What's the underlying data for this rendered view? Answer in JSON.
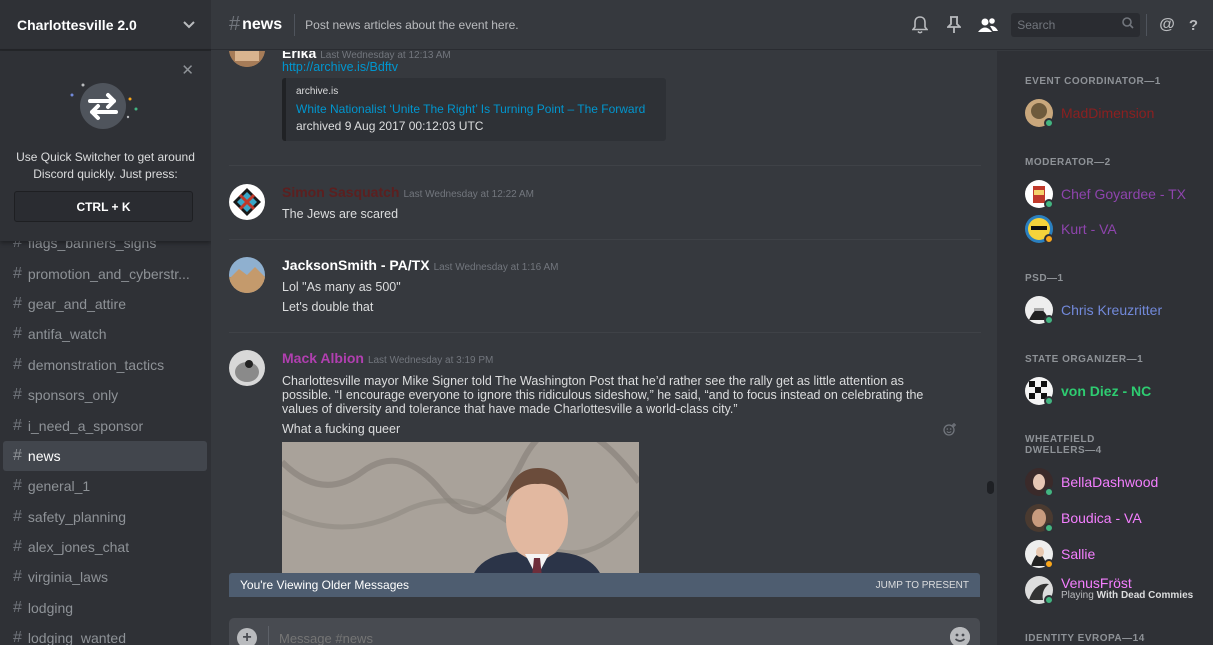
{
  "guild": {
    "name": "Charlottesville 2.0"
  },
  "quick_switcher": {
    "text": "Use Quick Switcher to get around Discord quickly. Just press:",
    "shortcut": "CTRL + K"
  },
  "channels": [
    {
      "name": "flags_banners_signs",
      "active": false
    },
    {
      "name": "promotion_and_cyberstr...",
      "active": false
    },
    {
      "name": "gear_and_attire",
      "active": false
    },
    {
      "name": "antifa_watch",
      "active": false
    },
    {
      "name": "demonstration_tactics",
      "active": false
    },
    {
      "name": "sponsors_only",
      "active": false
    },
    {
      "name": "i_need_a_sponsor",
      "active": false
    },
    {
      "name": "news",
      "active": true
    },
    {
      "name": "general_1",
      "active": false
    },
    {
      "name": "safety_planning",
      "active": false
    },
    {
      "name": "alex_jones_chat",
      "active": false
    },
    {
      "name": "virginia_laws",
      "active": false
    },
    {
      "name": "lodging",
      "active": false
    },
    {
      "name": "lodging_wanted",
      "active": false
    }
  ],
  "header": {
    "hash": "#",
    "channel": "news",
    "topic": "Post news articles about the event here.",
    "search_placeholder": "Search",
    "at": "@",
    "help": "?"
  },
  "messages": [
    {
      "author": "Erika",
      "color": "#ffffff",
      "timestamp": "Last Wednesday at 12:13 AM",
      "lines": [
        "http://archive.is/Bdftv"
      ],
      "embed": {
        "provider": "archive.is",
        "title": "White Nationalist ‘Unite The Right’ Is Turning Point – The Forward",
        "description": "archived 9 Aug 2017 00:12:03 UTC"
      }
    },
    {
      "author": "Simon Sasquatch",
      "color": "#5c1f1f",
      "timestamp": "Last Wednesday at 12:22 AM",
      "lines": [
        "The Jews are scared"
      ]
    },
    {
      "author": "JacksonSmith - PA/TX",
      "color": "#ffffff",
      "timestamp": "Last Wednesday at 1:16 AM",
      "lines": [
        "Lol \"As many as 500\"",
        "Let's double that"
      ]
    },
    {
      "author": "Mack Albion",
      "color": "#b13fb0",
      "timestamp": "Last Wednesday at 3:19 PM",
      "lines": [
        "Charlottesville mayor Mike Signer told The Washington Post that he’d rather see the rally get as little attention as possible. “I encourage everyone to ignore this ridiculous sideshow,” he said, “and to focus instead on celebrating the values of diversity and tolerance that have made Charlottesville a world-class city.”",
        "What a fucking queer"
      ]
    }
  ],
  "older_bar": {
    "text": "You're Viewing Older Messages",
    "jump": "JUMP TO PRESENT"
  },
  "composer": {
    "placeholder": "Message #news"
  },
  "members": {
    "groups": [
      {
        "role": "EVENT COORDINATOR—1",
        "members": [
          {
            "name": "MadDimension",
            "color": "#8b2020",
            "status": "online"
          }
        ]
      },
      {
        "role": "MODERATOR—2",
        "members": [
          {
            "name": "Chef Goyardee - TX",
            "color": "#8e44ad",
            "status": "online"
          },
          {
            "name": "Kurt - VA",
            "color": "#8e44ad",
            "status": "idle"
          }
        ]
      },
      {
        "role": "PSD—1",
        "members": [
          {
            "name": "Chris Kreuzritter",
            "color": "#7289da",
            "status": "online"
          }
        ]
      },
      {
        "role": "STATE ORGANIZER—1",
        "members": [
          {
            "name": "von Diez - NC",
            "color": "#2ecc71",
            "status": "online"
          }
        ]
      },
      {
        "role": "WHEATFIELD DWELLERS—4",
        "members": [
          {
            "name": "BellaDashwood",
            "color": "#f47fff",
            "status": "online"
          },
          {
            "name": "Boudica - VA",
            "color": "#f47fff",
            "status": "online"
          },
          {
            "name": "Sallie",
            "color": "#f47fff",
            "status": "idle"
          },
          {
            "name": "VenusFröst",
            "color": "#f47fff",
            "status": "online",
            "playing_prefix": "Playing",
            "playing_game": "With Dead Commies"
          }
        ]
      },
      {
        "role": "IDENTITY EVROPA—14",
        "members": []
      }
    ]
  },
  "colors": {
    "bg": "#36393e",
    "sidebar": "#2f3136",
    "link": "#0096cf",
    "older_bar": "#4e5d70"
  }
}
